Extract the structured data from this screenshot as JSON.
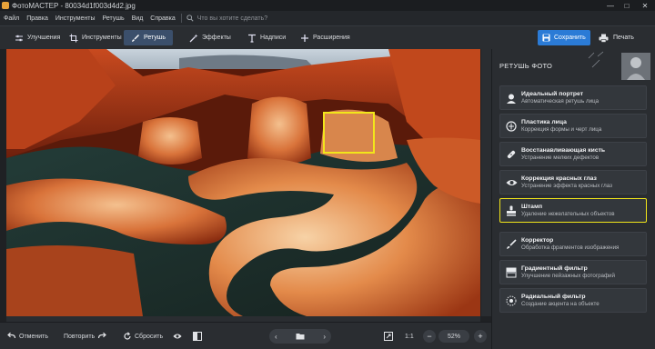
{
  "window": {
    "title": "ФотоМАСТЕР - 80034d1f003d4d2.jpg",
    "controls": [
      "—",
      "□",
      "✕"
    ]
  },
  "menu": {
    "items": [
      "Файл",
      "Правка",
      "Инструменты",
      "Ретушь",
      "Вид",
      "Справка"
    ],
    "search_placeholder": "Что вы хотите сделать?"
  },
  "toolbar": {
    "tabs": [
      {
        "label": "Улучшения",
        "icon": "sliders-icon",
        "active": false
      },
      {
        "label": "Инструменты",
        "icon": "crop-icon",
        "active": false
      },
      {
        "label": "Ретушь",
        "icon": "brush-icon",
        "active": true
      },
      {
        "label": "Эффекты",
        "icon": "magic-wand-icon",
        "active": false
      },
      {
        "label": "Надписи",
        "icon": "text-icon",
        "active": false
      },
      {
        "label": "Расширения",
        "icon": "plus-icon",
        "active": false
      }
    ],
    "save_label": "Сохранить",
    "print_label": "Печать"
  },
  "panel": {
    "title": "РЕТУШЬ ФОТО",
    "tools": [
      {
        "title": "Идеальный портрет",
        "subtitle": "Автоматическая ретушь лица",
        "icon": "portrait-icon",
        "highlighted": false
      },
      {
        "title": "Пластика лица",
        "subtitle": "Коррекция формы и черт лица",
        "icon": "face-shape-icon",
        "highlighted": false
      },
      {
        "title": "Восстанавливающая кисть",
        "subtitle": "Устранение мелких дефектов",
        "icon": "bandage-icon",
        "highlighted": false
      },
      {
        "title": "Коррекция красных глаз",
        "subtitle": "Устранение эффекта красных глаз",
        "icon": "eye-icon",
        "highlighted": false
      },
      {
        "title": "Штамп",
        "subtitle": "Удаление нежелательных объектов",
        "icon": "stamp-icon",
        "highlighted": true
      },
      {
        "title": "Корректор",
        "subtitle": "Обработка фрагментов изображения",
        "icon": "corrector-brush-icon",
        "highlighted": false
      },
      {
        "title": "Градиентный фильтр",
        "subtitle": "Улучшение пейзажных фотографий",
        "icon": "gradient-icon",
        "highlighted": false
      },
      {
        "title": "Радиальный фильтр",
        "subtitle": "Создание акцента на объекте",
        "icon": "radial-icon",
        "highlighted": false
      }
    ]
  },
  "bottom": {
    "undo_label": "Отменить",
    "redo_label": "Повторить",
    "reset_label": "Сбросить",
    "zoom_ratio_label": "1:1",
    "zoom_value": "52%",
    "zoom_out": "−",
    "zoom_in": "+",
    "prev": "‹",
    "next": "›"
  },
  "colors": {
    "accent": "#2b7bd6",
    "highlight": "#f2e61a",
    "active_tab": "#3b4f6b"
  }
}
